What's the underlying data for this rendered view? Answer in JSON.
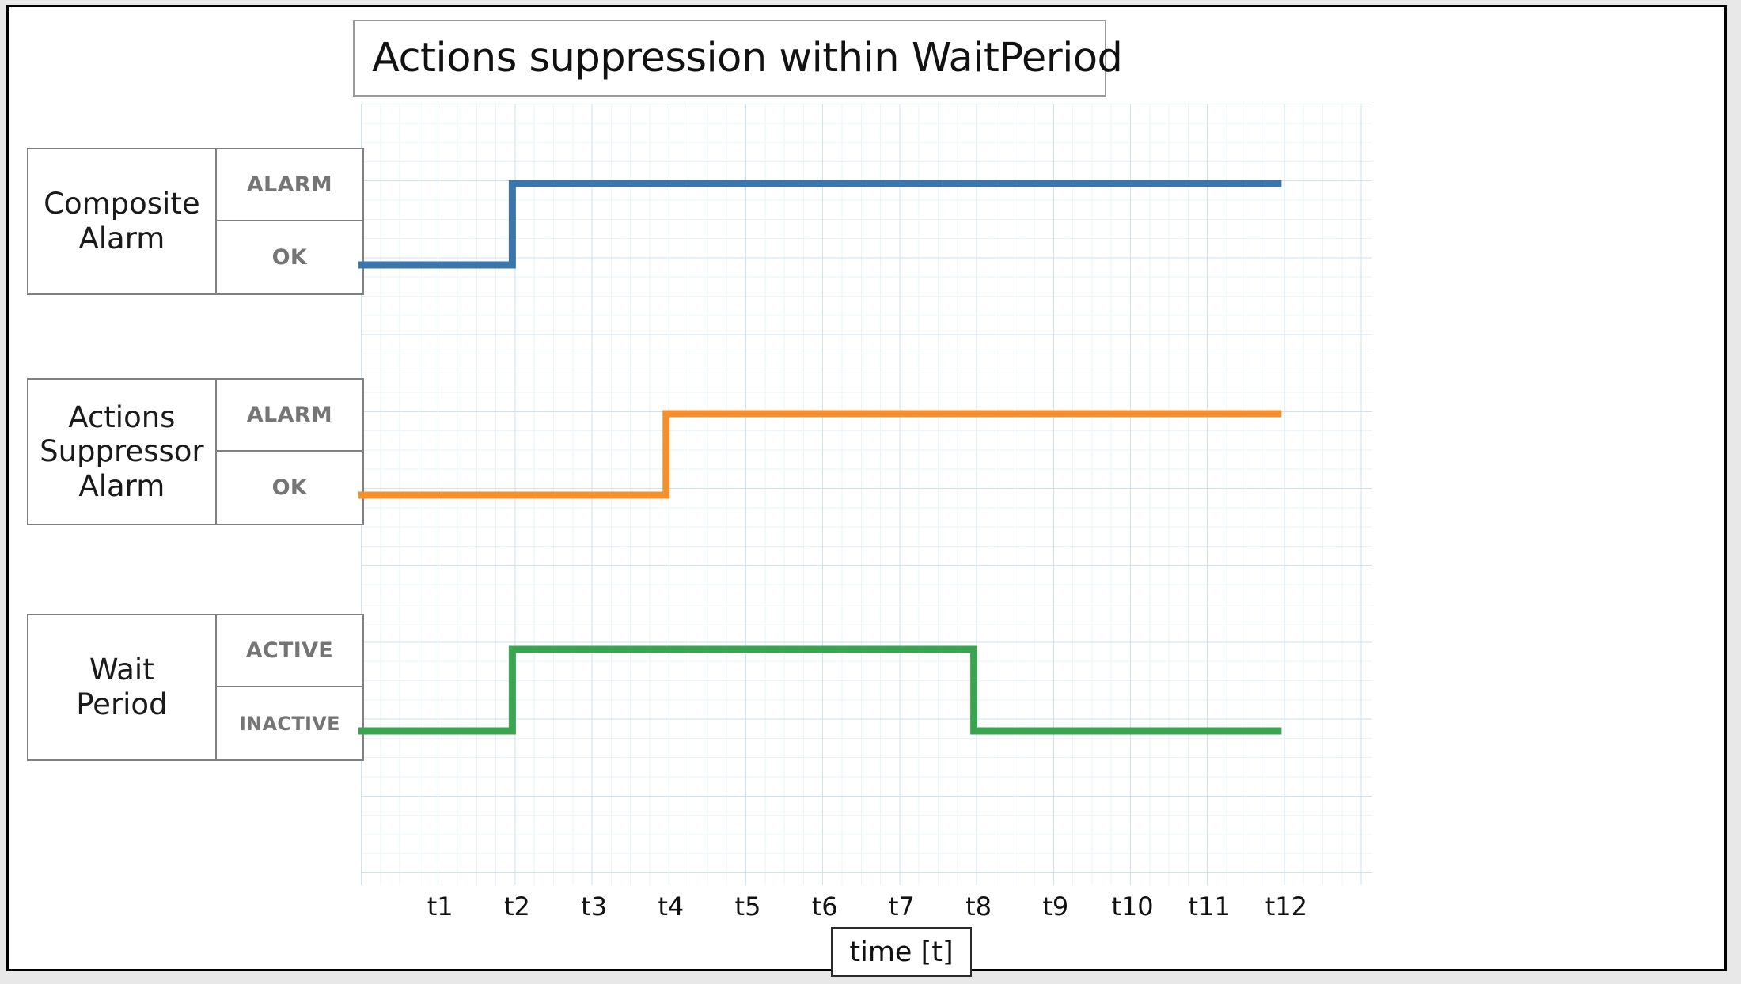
{
  "figure": {
    "title": "Actions suppression within WaitPeriod",
    "x_axis_label": "time [t]"
  },
  "rows": [
    {
      "name": "Composite\nAlarm",
      "name_line1": "Composite",
      "name_line2": "Alarm",
      "state_high": "ALARM",
      "state_low": "OK",
      "color": "#3a76ab"
    },
    {
      "name": "Actions\nSuppressor\nAlarm",
      "name_line1": "Actions",
      "name_line2": "Suppressor",
      "name_line3": "Alarm",
      "state_high": "ALARM",
      "state_low": "OK",
      "color": "#f4912e"
    },
    {
      "name": "Wait\nPeriod",
      "name_line1": "Wait",
      "name_line2": "Period",
      "state_high": "ACTIVE",
      "state_low": "INACTIVE",
      "color": "#3ba450"
    }
  ],
  "xticks": [
    "t1",
    "t2",
    "t3",
    "t4",
    "t5",
    "t6",
    "t7",
    "t8",
    "t9",
    "t10",
    "t11",
    "t12"
  ],
  "chart_data": {
    "type": "line",
    "title": "Actions suppression within WaitPeriod",
    "xlabel": "time [t]",
    "ylabel": "",
    "grid": true,
    "legend": "none",
    "x": [
      "t1",
      "t2",
      "t3",
      "t4",
      "t5",
      "t6",
      "t7",
      "t8",
      "t9",
      "t10",
      "t11",
      "t12"
    ],
    "xlim": [
      "t0",
      "t13"
    ],
    "series": [
      {
        "name": "Composite Alarm",
        "color": "#3a76ab",
        "states": [
          "OK",
          "ALARM"
        ],
        "step": "post",
        "values": [
          "OK",
          "ALARM",
          "ALARM",
          "ALARM",
          "ALARM",
          "ALARM",
          "ALARM",
          "ALARM",
          "ALARM",
          "ALARM",
          "ALARM",
          "ALARM"
        ],
        "transitions": [
          {
            "at": "t2",
            "from": "OK",
            "to": "ALARM"
          }
        ]
      },
      {
        "name": "Actions Suppressor Alarm",
        "color": "#f4912e",
        "states": [
          "OK",
          "ALARM"
        ],
        "step": "post",
        "values": [
          "OK",
          "OK",
          "OK",
          "ALARM",
          "ALARM",
          "ALARM",
          "ALARM",
          "ALARM",
          "ALARM",
          "ALARM",
          "ALARM",
          "ALARM"
        ],
        "transitions": [
          {
            "at": "t4",
            "from": "OK",
            "to": "ALARM"
          }
        ]
      },
      {
        "name": "Wait Period",
        "color": "#3ba450",
        "states": [
          "INACTIVE",
          "ACTIVE"
        ],
        "step": "post",
        "values": [
          "INACTIVE",
          "ACTIVE",
          "ACTIVE",
          "ACTIVE",
          "ACTIVE",
          "ACTIVE",
          "ACTIVE",
          "INACTIVE",
          "INACTIVE",
          "INACTIVE",
          "INACTIVE",
          "INACTIVE"
        ],
        "transitions": [
          {
            "at": "t2",
            "from": "INACTIVE",
            "to": "ACTIVE"
          },
          {
            "at": "t8",
            "from": "ACTIVE",
            "to": "INACTIVE"
          }
        ]
      }
    ]
  }
}
